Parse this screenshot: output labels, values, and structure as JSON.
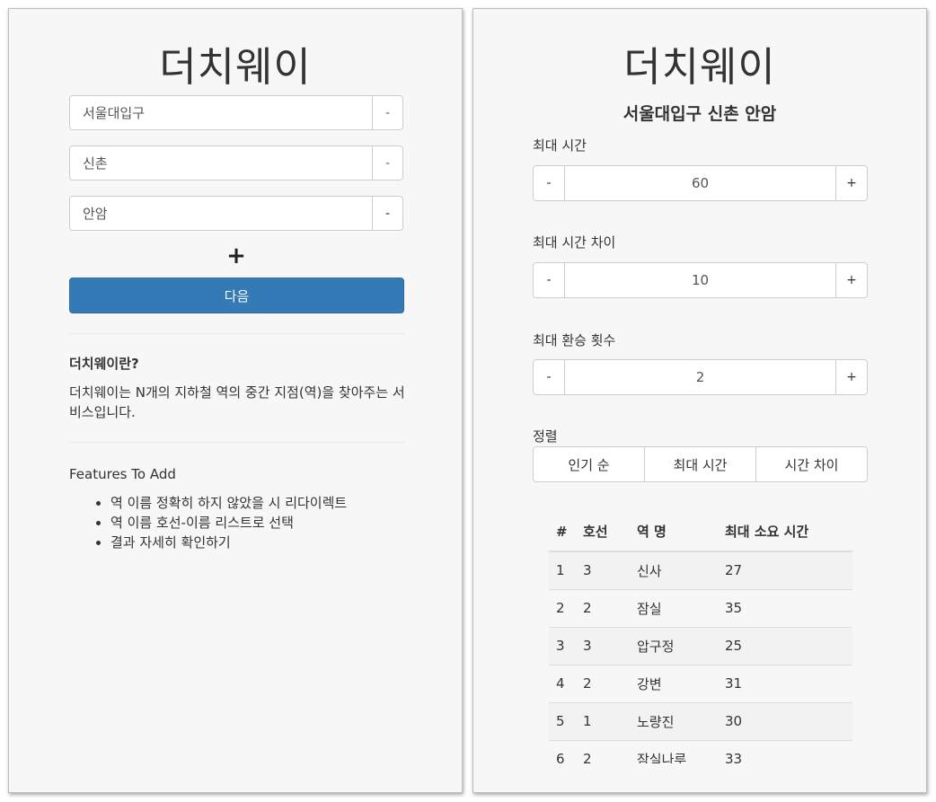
{
  "left": {
    "title": "더치웨이",
    "stations": [
      {
        "value": "서울대입구",
        "remove_label": "-"
      },
      {
        "value": "신촌",
        "remove_label": "-"
      },
      {
        "value": "안암",
        "remove_label": "-"
      }
    ],
    "add_label": "+",
    "next_label": "다음",
    "about_title": "더치웨이란?",
    "about_desc": "더치웨이는 N개의 지하철 역의 중간 지점(역)을 찾아주는 서비스입니다.",
    "features_title": "Features To Add",
    "features": [
      "역 이름 정확히 하지 않았을 시 리다이렉트",
      "역 이름 호선-이름 리스트로 선택",
      "결과 자세히 확인하기"
    ]
  },
  "right": {
    "title": "더치웨이",
    "stations_heading": "서울대입구 신촌 안암",
    "max_time": {
      "label": "최대 시간",
      "minus": "-",
      "value": "60",
      "plus": "+"
    },
    "max_time_diff": {
      "label": "최대 시간 차이",
      "minus": "-",
      "value": "10",
      "plus": "+"
    },
    "max_transfers": {
      "label": "최대 환승 횟수",
      "minus": "-",
      "value": "2",
      "plus": "+"
    },
    "sort": {
      "label": "정렬",
      "options": [
        "인기 순",
        "최대 시간",
        "시간 차이"
      ]
    },
    "table": {
      "headers": [
        "#",
        "호선",
        "역 명",
        "최대 소요 시간"
      ],
      "rows": [
        [
          "1",
          "3",
          "신사",
          "27"
        ],
        [
          "2",
          "2",
          "잠실",
          "35"
        ],
        [
          "3",
          "3",
          "압구정",
          "25"
        ],
        [
          "4",
          "2",
          "강변",
          "31"
        ],
        [
          "5",
          "1",
          "노량진",
          "30"
        ],
        [
          "6",
          "2",
          "잠실나루",
          "33"
        ]
      ]
    }
  },
  "colors": {
    "primary": "#337ab7",
    "panel_bg": "#f7f7f7",
    "border": "#cccccc"
  }
}
